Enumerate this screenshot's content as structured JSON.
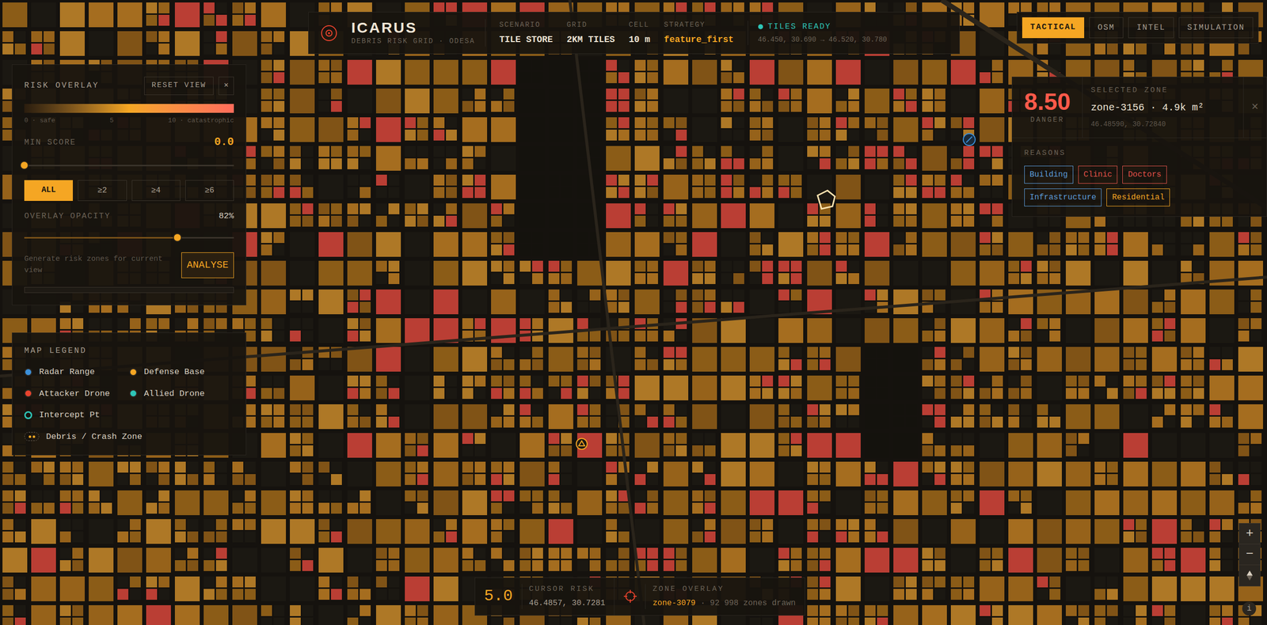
{
  "header": {
    "title": "ICARUS",
    "subtitle": "DEBRIS RISK GRID · ODESA",
    "fields": [
      {
        "label": "SCENARIO",
        "value": "TILE STORE",
        "highlight": false
      },
      {
        "label": "GRID",
        "value": "2KM TILES",
        "highlight": false
      },
      {
        "label": "CELL",
        "value": "10 m",
        "highlight": false
      },
      {
        "label": "STRATEGY",
        "value": "feature_first",
        "highlight": true
      }
    ],
    "status": {
      "label": "TILES READY",
      "bounds": "46.450, 30.690 → 46.520, 30.780",
      "ok": true
    }
  },
  "tabs": [
    {
      "label": "TACTICAL",
      "selected": true
    },
    {
      "label": "OSM",
      "selected": false
    },
    {
      "label": "INTEL",
      "selected": false
    },
    {
      "label": "SIMULATION",
      "selected": false
    }
  ],
  "risk_overlay": {
    "title": "RISK OVERLAY",
    "reset": "RESET VIEW",
    "close": "✕",
    "scale": {
      "min": "0 · safe",
      "mid": "5",
      "max": "10 · catastrophic"
    },
    "min_score": {
      "label": "MIN SCORE",
      "value": "0.0",
      "level": 0
    },
    "filters": [
      {
        "label": "ALL",
        "selected": true
      },
      {
        "label": "≥2",
        "selected": false
      },
      {
        "label": "≥4",
        "selected": false
      },
      {
        "label": "≥6",
        "selected": false
      }
    ],
    "opacity": {
      "label": "OVERLAY OPACITY",
      "value": "82%",
      "level": 0.73
    },
    "analyse": {
      "hint": "Generate risk zones for current view",
      "button": "ANALYSE",
      "progress": 0
    }
  },
  "legend": {
    "title": "MAP LEGEND",
    "items": [
      {
        "label": "Radar Range",
        "color": "#3b8fd9",
        "kind": "dot"
      },
      {
        "label": "Defense Base",
        "color": "#f5a623",
        "kind": "dot"
      },
      {
        "label": "Attacker Drone",
        "color": "#e8432d",
        "kind": "dot"
      },
      {
        "label": "Allied Drone",
        "color": "#2ec4b6",
        "kind": "dot"
      },
      {
        "label": "Intercept Pt",
        "color": "#2ec4b6",
        "kind": "ring"
      },
      {
        "label": "Debris / Crash Zone",
        "color": "#f5a623",
        "kind": "zone"
      }
    ]
  },
  "selected_zone": {
    "score": "8.50",
    "score_label": "DANGER",
    "title": "SELECTED ZONE",
    "zone": "zone-3156 · 4.9k m²",
    "coords": "46.48590, 30.72840",
    "close": "×",
    "reasons_title": "REASONS",
    "reasons": [
      {
        "label": "Building",
        "color": "#5b9bd9"
      },
      {
        "label": "Clinic",
        "color": "#e0524a"
      },
      {
        "label": "Doctors",
        "color": "#e0524a"
      },
      {
        "label": "Infrastructure",
        "color": "#5b9bd9"
      },
      {
        "label": "Residential",
        "color": "#f5a623"
      }
    ]
  },
  "status_bar": {
    "cursor_value": "5.0",
    "cursor_label": "CURSOR RISK",
    "cursor_coords": "46.4857, 30.7281",
    "zone_label": "ZONE OVERLAY",
    "zone": "zone-3079",
    "zone_count": "· 92 998 zones drawn"
  },
  "zoom": {
    "in": "+",
    "out": "−",
    "info": "i"
  }
}
